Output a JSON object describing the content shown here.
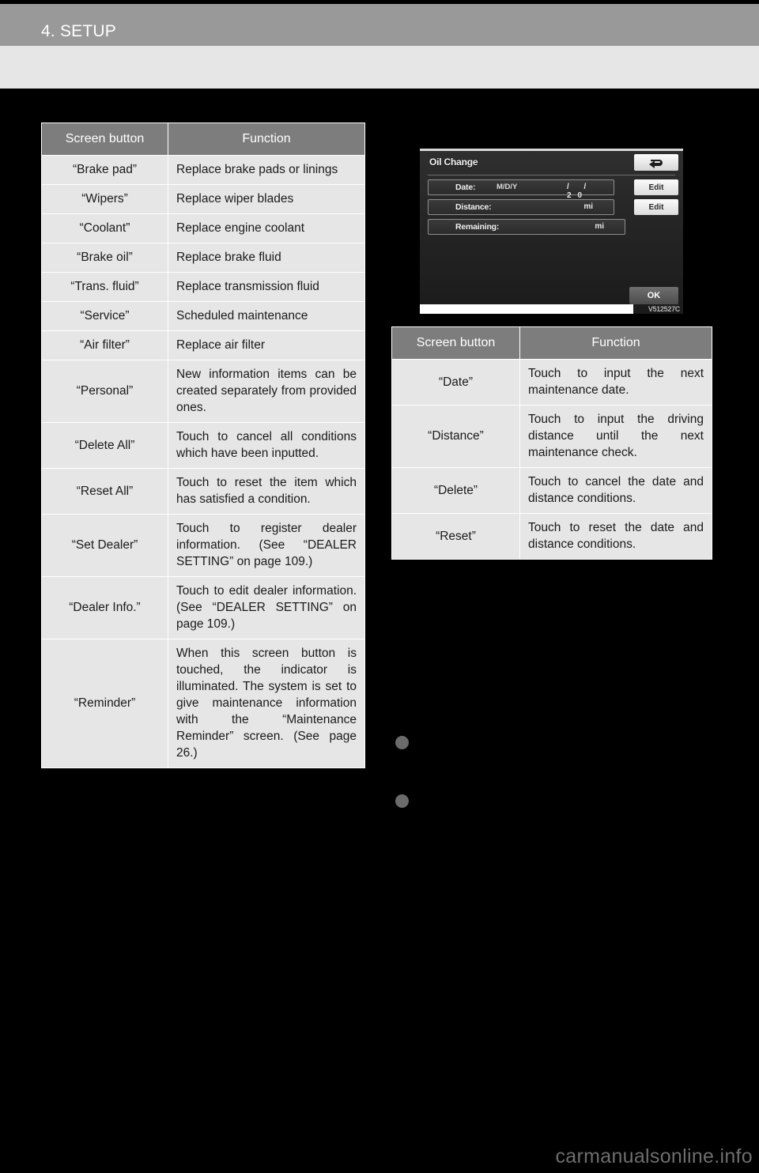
{
  "header": {
    "chapter_title": "4. SETUP"
  },
  "left_table": {
    "columns": [
      "Screen button",
      "Function"
    ],
    "rows": [
      {
        "button": "“Brake pad”",
        "function": "Replace brake pads or linings"
      },
      {
        "button": "“Wipers”",
        "function": "Replace wiper blades"
      },
      {
        "button": "“Coolant”",
        "function": "Replace engine coolant"
      },
      {
        "button": "“Brake oil”",
        "function": "Replace brake fluid"
      },
      {
        "button": "“Trans. fluid”",
        "function": "Replace transmission fluid"
      },
      {
        "button": "“Service”",
        "function": "Scheduled maintenance"
      },
      {
        "button": "“Air filter”",
        "function": "Replace air filter"
      },
      {
        "button": "“Personal”",
        "function": "New information items can be created separately from provided ones."
      },
      {
        "button": "“Delete All”",
        "function": "Touch to cancel all conditions which have been inputted."
      },
      {
        "button": "“Reset All”",
        "function": "Touch to reset the item which has satisfied a condition."
      },
      {
        "button": "“Set Dealer”",
        "function": "Touch to register dealer information. (See “DEALER SETTING” on page 109.)"
      },
      {
        "button": "“Dealer Info.”",
        "function": "Touch to edit dealer information. (See “DEALER SETTING” on page 109.)"
      },
      {
        "button": "“Reminder”",
        "function": "When this screen button is touched, the indicator is illuminated. The system is set to give maintenance information with the “Maintenance Reminder” screen. (See page 26.)"
      }
    ]
  },
  "device_screenshot": {
    "title": "Oil Change",
    "back_icon": "back-arrow-icon",
    "rows": [
      {
        "label": "Date:",
        "format": "M/D/Y",
        "slashes": "/   / 20",
        "unit": "",
        "edit_label": "Edit"
      },
      {
        "label": "Distance:",
        "format": "",
        "slashes": "",
        "unit": "mi",
        "edit_label": "Edit"
      },
      {
        "label": "Remaining:",
        "format": "",
        "slashes": "",
        "unit": "mi",
        "edit_label": ""
      }
    ],
    "ok_label": "OK",
    "figure_code": "V512527C"
  },
  "right_table": {
    "columns": [
      "Screen button",
      "Function"
    ],
    "rows": [
      {
        "button": "“Date”",
        "function": "Touch to input the next maintenance date."
      },
      {
        "button": "“Distance”",
        "function": "Touch to input the driving distance until the next maintenance check."
      },
      {
        "button": "“Delete”",
        "function": "Touch to cancel the date and distance conditions."
      },
      {
        "button": "“Reset”",
        "function": "Touch to reset the date and distance conditions."
      }
    ]
  },
  "bullets": [
    {
      "marker": "bullet-dot",
      "text": ""
    },
    {
      "marker": "bullet-dot",
      "text": ""
    }
  ],
  "watermark": "carmanualsonline.info",
  "colors": {
    "header_gray": "#999999",
    "subheader_gray": "#e6e6e6",
    "table_header_gray": "#7d7d7d",
    "table_cell_gray": "#e6e6e6",
    "page_background": "#000000",
    "bullet_gray": "#6b6b6b"
  }
}
